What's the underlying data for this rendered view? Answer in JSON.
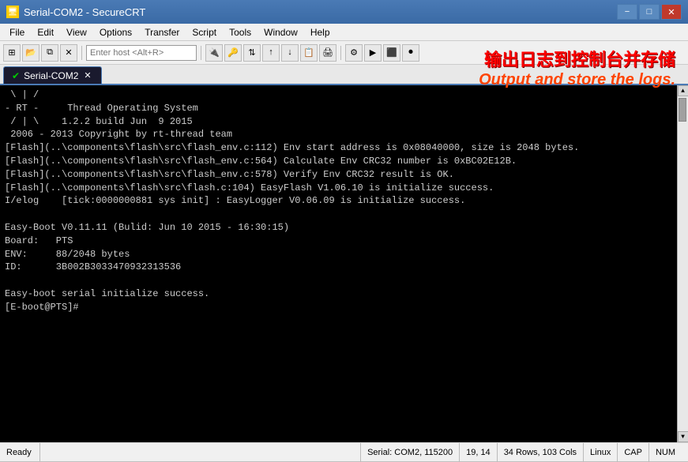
{
  "window": {
    "title": "Serial-COM2 - SecureCRT",
    "icon": "🖥"
  },
  "titlebar": {
    "minimize": "−",
    "restore": "□",
    "close": "✕"
  },
  "menubar": {
    "items": [
      "File",
      "Edit",
      "View",
      "Options",
      "Transfer",
      "Script",
      "Tools",
      "Window",
      "Help"
    ]
  },
  "toolbar": {
    "host_placeholder": "Enter host <Alt+R>"
  },
  "overlay": {
    "line1": "输出日志到控制台并存储",
    "line2": "Output and store the logs."
  },
  "tabs": [
    {
      "label": "Serial-COM2",
      "active": true
    }
  ],
  "terminal": {
    "lines": [
      " \\ | /",
      "- RT -     Thread Operating System",
      " / | \\    1.2.2 build Jun  9 2015",
      " 2006 - 2013 Copyright by rt-thread team",
      "[Flash](..\\components\\flash\\src\\flash_env.c:112) Env start address is 0x08040000, size is 2048 bytes.",
      "[Flash](..\\components\\flash\\src\\flash_env.c:564) Calculate Env CRC32 number is 0xBC02E12B.",
      "[Flash](..\\components\\flash\\src\\flash_env.c:578) Verify Env CRC32 result is OK.",
      "[Flash](..\\components\\flash\\src\\flash.c:104) EasyFlash V1.06.10 is initialize success.",
      "I/elog    [tick:0000000881 sys init] : EasyLogger V0.06.09 is initialize success.",
      "",
      "Easy-Boot V0.11.11 (Bulid: Jun 10 2015 - 16:30:15)",
      "Board:   PTS",
      "ENV:     88/2048 bytes",
      "ID:      3B002B3033470932313536",
      "",
      "Easy-boot serial initialize success.",
      "[E-boot@PTS]#"
    ]
  },
  "statusbar": {
    "ready": "Ready",
    "connection": "Serial: COM2, 115200",
    "position": "19, 14",
    "size": "34 Rows, 103 Cols",
    "os": "Linux",
    "cap": "CAP",
    "num": "NUM"
  }
}
